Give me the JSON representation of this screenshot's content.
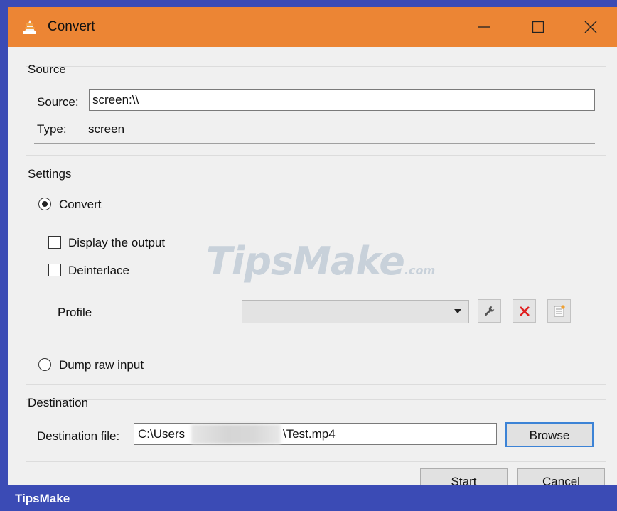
{
  "window": {
    "title": "Convert"
  },
  "source": {
    "group_label": "Source",
    "source_label": "Source:",
    "source_value": "screen:\\\\",
    "type_label": "Type:",
    "type_value": "screen"
  },
  "settings": {
    "group_label": "Settings",
    "convert_label": "Convert",
    "convert_selected": true,
    "display_output_label": "Display the output",
    "deinterlace_label": "Deinterlace",
    "profile_label": "Profile",
    "profile_value": "",
    "dump_raw_label": "Dump raw input"
  },
  "destination": {
    "group_label": "Destination",
    "file_label": "Destination file:",
    "file_prefix": "C:\\Users",
    "file_suffix": "\\Test.mp4",
    "browse_label": "Browse"
  },
  "buttons": {
    "start_label": "Start",
    "cancel_label": "Cancel"
  },
  "watermark": {
    "main": "TipsMake",
    "suffix": ".com"
  },
  "footer": {
    "brand": "TipsMake"
  },
  "colors": {
    "titlebar": "#ec8534",
    "footer": "#3b4bb5",
    "delete_icon": "#e02020"
  }
}
